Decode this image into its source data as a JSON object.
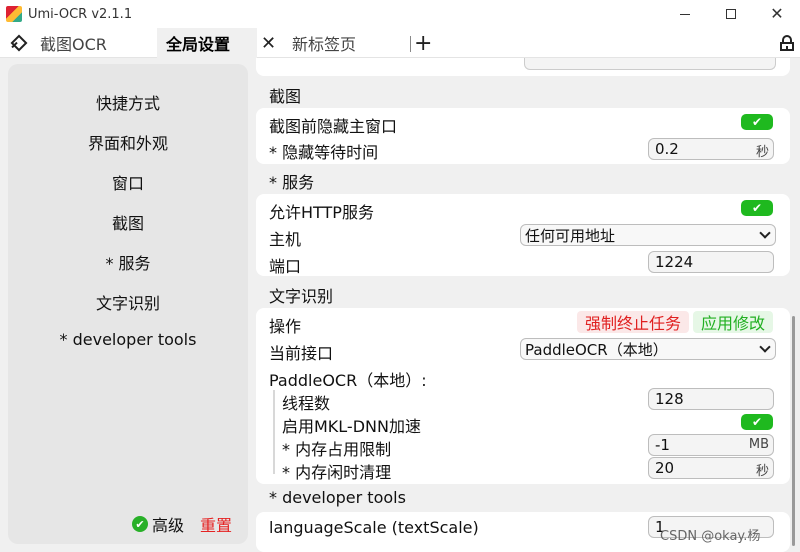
{
  "window": {
    "title": "Umi-OCR v2.1.1",
    "min_label": "",
    "close_label": "✕"
  },
  "tabs": [
    {
      "label": "截图OCR"
    },
    {
      "label": "全局设置"
    },
    {
      "label": "新标签页"
    }
  ],
  "tabbar": {
    "close": "✕",
    "plus": "+"
  },
  "sidebar": {
    "items": [
      "快捷方式",
      "界面和外观",
      "窗口",
      "截图",
      "* 服务",
      "文字识别",
      "* developer tools"
    ],
    "advanced_label": "高级",
    "reset_label": "重置"
  },
  "sections": {
    "screenshot": {
      "title": "截图",
      "hide_main_label": "截图前隐藏主窗口",
      "hide_wait_label": "* 隐藏等待时间",
      "hide_wait_value": "0.2",
      "hide_wait_unit": "秒"
    },
    "service": {
      "title": "* 服务",
      "allow_http_label": "允许HTTP服务",
      "host_label": "主机",
      "host_value": "任何可用地址",
      "port_label": "端口",
      "port_value": "1224"
    },
    "ocr": {
      "title": "文字识别",
      "operation_label": "操作",
      "force_stop_label": "强制终止任务",
      "apply_label": "应用修改",
      "interface_label": "当前接口",
      "interface_value": "PaddleOCR（本地）",
      "paddle_label": "PaddleOCR（本地）:",
      "threads_label": "线程数",
      "threads_value": "128",
      "mkldnn_label": "启用MKL-DNN加速",
      "mem_limit_label": "* 内存占用限制",
      "mem_limit_value": "-1",
      "mem_limit_unit": "MB",
      "mem_clean_label": "* 内存闲时清理",
      "mem_clean_value": "20",
      "mem_clean_unit": "秒"
    },
    "dev": {
      "title": "* developer tools",
      "lang_scale_label": "languageScale (textScale)",
      "lang_scale_value": "1"
    }
  },
  "toggle_glyph": "✔",
  "watermark": "CSDN @okay.杨"
}
